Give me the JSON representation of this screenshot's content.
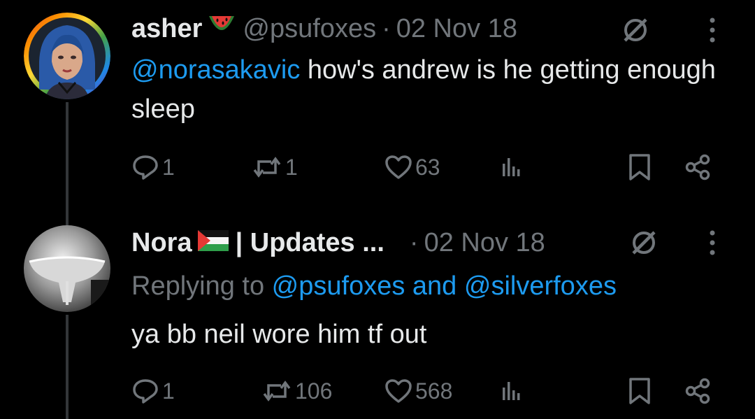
{
  "tweets": [
    {
      "name": "asher",
      "handle": "@psufoxes",
      "separator": "·",
      "date": "02 Nov 18",
      "emoji_icon": "watermelon-icon",
      "text_mention": "@norasakavic",
      "text_rest": " how's andrew is he getting enough sleep",
      "actions": {
        "replies": "1",
        "reposts": "1",
        "likes": "63"
      }
    },
    {
      "name": "Nora",
      "name_suffix": "| Updates ...",
      "separator": "·",
      "date": "02 Nov 18",
      "emoji_icon": "palestine-flag-icon",
      "replying_prefix": "Replying to ",
      "replying_to_1": "@psufoxes",
      "replying_and": " and ",
      "replying_to_2": "@silverfoxes",
      "text": "ya bb neil wore him tf out",
      "actions": {
        "replies": "1",
        "reposts": "106",
        "likes": "568"
      }
    }
  ],
  "colors": {
    "background": "#000000",
    "text": "#e7e9ea",
    "muted": "#71767b",
    "link": "#1d9bf0"
  }
}
